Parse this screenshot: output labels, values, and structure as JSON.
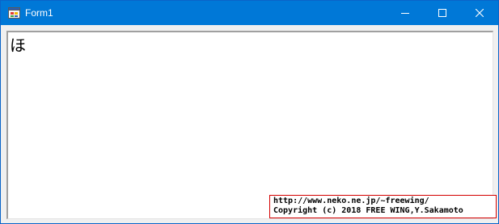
{
  "window": {
    "title": "Form1",
    "icon": "winforms-app-icon",
    "controls": {
      "minimize_icon": "minimize-icon",
      "maximize_icon": "maximize-icon",
      "close_icon": "close-icon"
    },
    "titlebar_color": "#0078d7"
  },
  "editor": {
    "text": "ほ"
  },
  "copyright": {
    "url": "http://www.neko.ne.jp/~freewing/",
    "notice": "Copyright (c) 2018 FREE WING,Y.Sakamoto",
    "border_color": "#d40000"
  }
}
